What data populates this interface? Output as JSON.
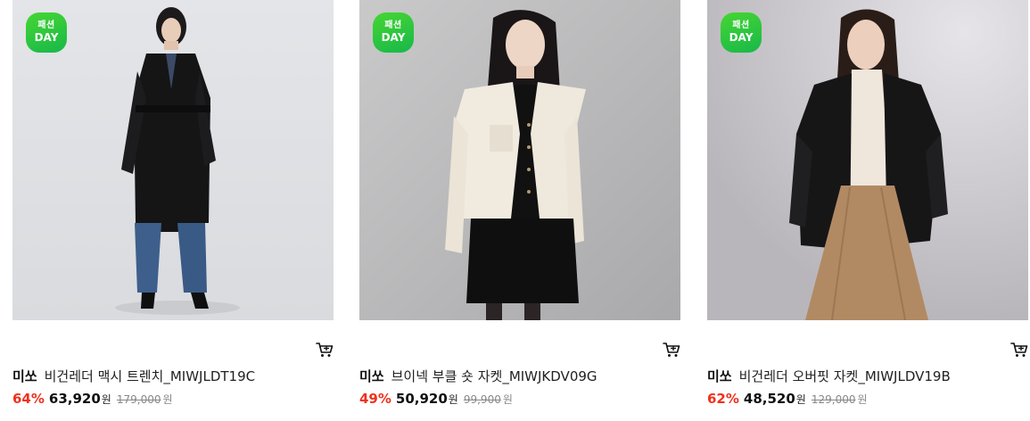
{
  "products": [
    {
      "badge_line1": "패션",
      "badge_line2": "DAY",
      "brand": "미쏘",
      "name": "비건레더 맥시 트렌치_MIWJLDT19C",
      "discount": "64%",
      "price": "63,920",
      "currency": "원",
      "original_price": "179,000",
      "original_currency": "원",
      "photo_icon": "model-photo",
      "cart_icon": "cart-icon"
    },
    {
      "badge_line1": "패션",
      "badge_line2": "DAY",
      "brand": "미쏘",
      "name": "브이넥 부클 숏 자켓_MIWJKDV09G",
      "discount": "49%",
      "price": "50,920",
      "currency": "원",
      "original_price": "99,900",
      "original_currency": "원",
      "photo_icon": "model-photo",
      "cart_icon": "cart-icon"
    },
    {
      "badge_line1": "패션",
      "badge_line2": "DAY",
      "brand": "미쏘",
      "name": "비건레더 오버핏 자켓_MIWJLDV19B",
      "discount": "62%",
      "price": "48,520",
      "currency": "원",
      "original_price": "129,000",
      "original_currency": "원",
      "photo_icon": "model-photo",
      "cart_icon": "cart-icon"
    }
  ],
  "colors": {
    "discount": "#f0311c",
    "badge": "#2ec43f",
    "text": "#111111",
    "muted": "#888888"
  }
}
